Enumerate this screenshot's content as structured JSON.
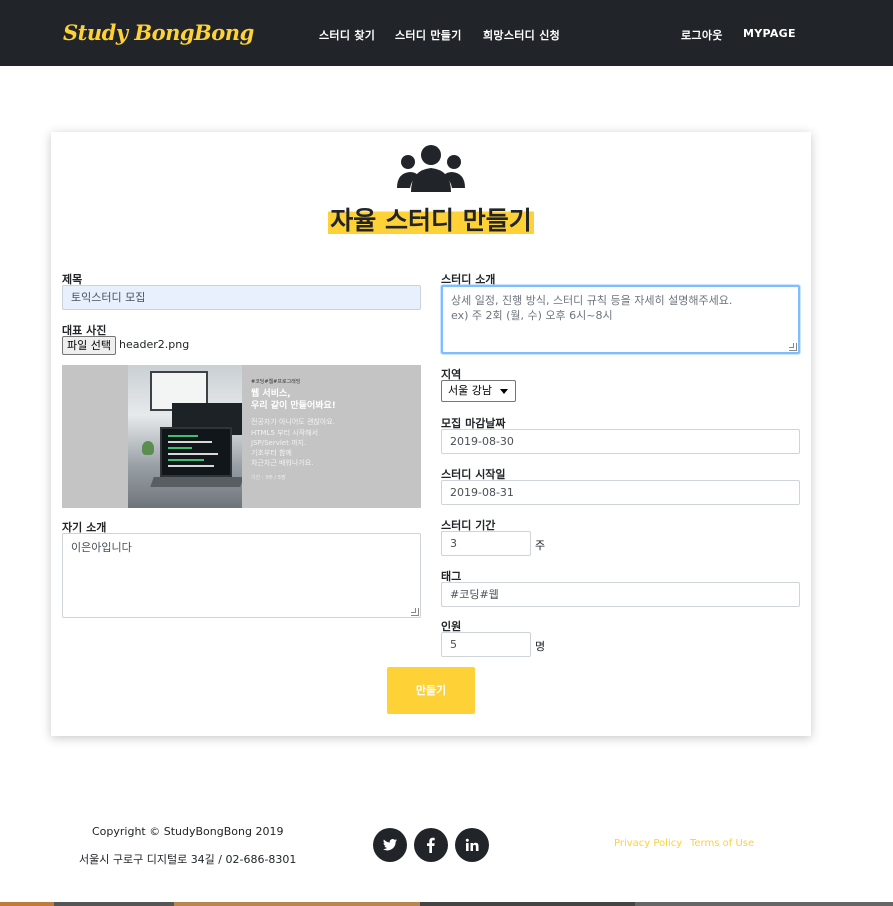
{
  "nav": {
    "brand": "Study BongBong",
    "links": [
      "스터디 찾기",
      "스터디 만들기",
      "희망스터디 신청"
    ],
    "logout": "로그아웃",
    "mypage": "MYPAGE"
  },
  "form": {
    "icon": "users-icon",
    "heading": "자율 스터디 만들기",
    "title_label": "제목",
    "title_value": "토익스터디 모집",
    "photo_label": "대표 사진",
    "file_button": "파일 선택",
    "file_name": "header2.png",
    "preview": {
      "small": "#코딩#웹#프로그래밍",
      "line1": "웹 서비스,",
      "line2": "우리 같이 만들어봐요!",
      "body1": "전공자가 아니어도 괜찮아요.",
      "body2": "HTML5 부터 시작해서",
      "body3": "JSP/Servlet 까지.",
      "body4": "기초부터 함께",
      "body5": "차근차근 배워나가요.",
      "footer": "기간 : 3주 / 5명"
    },
    "intro_label": "자기 소개",
    "intro_value": "이은아입니다",
    "desc_label": "스터디 소개",
    "desc_placeholder_1": "상세 일정, 진행 방식, 스터디 규칙 등을 자세히 설명해주세요.",
    "desc_placeholder_2": "ex) 주 2회 (월, 수) 오후  6시~8시",
    "region_label": "지역",
    "region_value": "서울 강남",
    "deadline_label": "모집 마감날짜",
    "deadline_value": "2019-08-30",
    "start_label": "스터디 시작일",
    "start_value": "2019-08-31",
    "duration_label": "스터디 기간",
    "duration_value": "3",
    "duration_unit": "주",
    "tag_label": "태그",
    "tag_value": "#코딩#웹",
    "people_label": "인원",
    "people_value": "5",
    "people_unit": "명",
    "submit": "만들기"
  },
  "footer": {
    "copyright": "Copyright © StudyBongBong 2019",
    "address": "서울시 구로구 디지털로 34길 / 02-686-8301",
    "social_icons": [
      "twitter-icon",
      "facebook-icon",
      "linkedin-icon"
    ],
    "privacy": "Privacy Policy",
    "terms": "Terms of Use"
  },
  "colors": {
    "accent": "#fed136",
    "dark": "#212529",
    "focus": "#80bdff",
    "autofill": "#e8f0fe"
  }
}
